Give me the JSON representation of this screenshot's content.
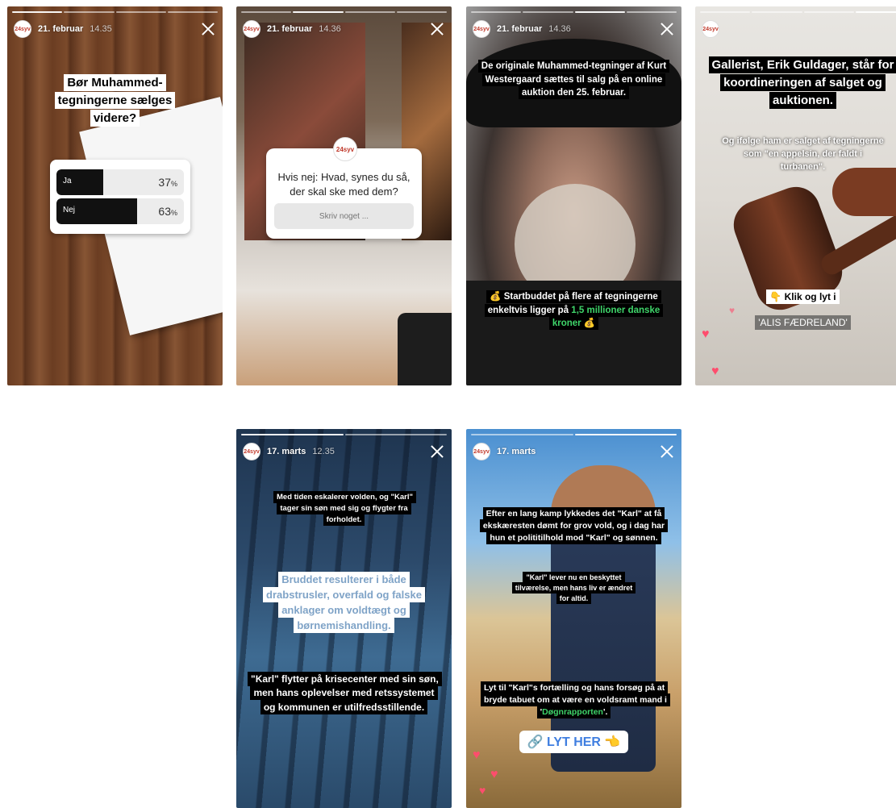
{
  "stories": [
    {
      "date": "21. februar",
      "time": "14.35",
      "poll": {
        "question": "Bør Muhammed-tegningerne sælges videre?",
        "options": [
          {
            "label": "Ja",
            "percent": "37",
            "fraction": 0.37
          },
          {
            "label": "Nej",
            "percent": "63",
            "fraction": 0.63
          }
        ],
        "pct_sign": "%"
      }
    },
    {
      "date": "21. februar",
      "time": "14.36",
      "question_sticker": {
        "logo": "24syv",
        "text": "Hvis nej: Hvad, synes du så, der skal ske med dem?",
        "placeholder": "Skriv noget ..."
      }
    },
    {
      "date": "21. februar",
      "time": "14.36",
      "caption_top": "De originale Muhammed-tegninger af Kurt Westergaard sættes til salg på en online auktion den 25. februar.",
      "caption_bottom_a": "💰 Startbuddet på flere af tegningerne enkeltvis ligger på ",
      "caption_bottom_green": "1,5 millioner danske kroner",
      "caption_bottom_b": " 💰"
    },
    {
      "date": "",
      "time": "",
      "caption_top": "Gallerist, Erik Guldager, står for koordineringen af salget og auktionen.",
      "caption_mid": "Og ifølge ham er salget af tegningerne som \"en appelsin, der faldt i turbanen\".",
      "cta": "👇 Klik og lyt i",
      "program": "'ALIS FÆDRELAND'"
    },
    {
      "date": "17. marts",
      "time": "12.35",
      "caption_top": "Med tiden eskalerer volden, og \"Karl\" tager sin søn med sig og flygter fra forholdet.",
      "caption_mid": "Bruddet resulterer i både drabstrusler, overfald og falske anklager om voldtægt og børnemishandling.",
      "caption_bottom": "\"Karl\" flytter på krisecenter med sin søn, men hans oplevelser med retssystemet og kommunen er utilfredsstillende."
    },
    {
      "date": "17. marts",
      "time": "",
      "caption_top": "Efter en lang kamp lykkedes det \"Karl\" at få ekskæresten dømt for grov vold, og i dag har hun et polititilhold mod \"Karl\" og sønnen.",
      "caption_mid": "\"Karl\" lever nu en beskyttet tilværelse, men hans liv er ændret for altid.",
      "caption_bottom_a": "Lyt til \"Karl\"s fortælling og hans forsøg på at bryde tabuet om at være en voldsramt mand i '",
      "caption_bottom_green": "Døgnrapporten",
      "caption_bottom_b": "'.",
      "link_label": "🔗 LYT HER 👈"
    }
  ],
  "avatar_label": "24syv",
  "colors": {
    "accent_green": "#3fd56a",
    "link_blue": "#3f7ee0"
  }
}
